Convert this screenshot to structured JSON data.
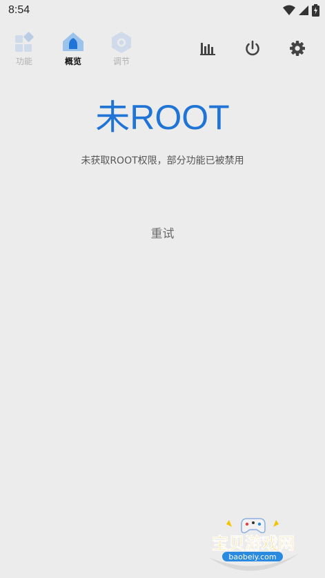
{
  "status_bar": {
    "time": "8:54",
    "icons": [
      "wifi-icon",
      "signal-icon",
      "battery-charging-icon"
    ]
  },
  "tabs": [
    {
      "label": "功能",
      "icon": "grid-diamond-icon",
      "active": false
    },
    {
      "label": "概览",
      "icon": "home-icon",
      "active": true
    },
    {
      "label": "调节",
      "icon": "hexagon-icon",
      "active": false
    }
  ],
  "actions": {
    "monitor_icon": "bar-chart-icon",
    "power_icon": "power-icon",
    "settings_icon": "gear-icon"
  },
  "main": {
    "title": "未ROOT",
    "description": "未获取ROOT权限，部分功能已被禁用",
    "retry_label": "重试"
  },
  "watermark": {
    "text": "宝贝游戏网",
    "url": "baobeiy.com"
  },
  "colors": {
    "accent": "#1f74d6",
    "background": "#ececec",
    "icon_inactive": "#c5d6ea"
  }
}
